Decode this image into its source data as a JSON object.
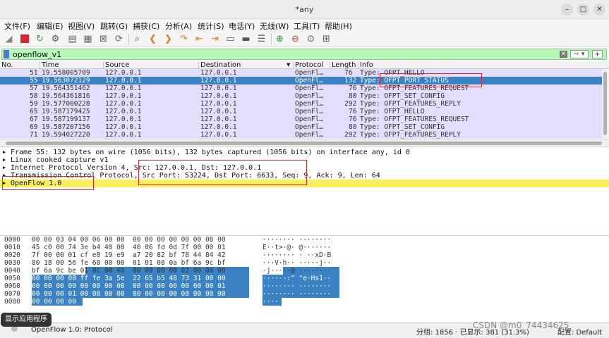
{
  "window": {
    "title": "*any"
  },
  "menu": [
    "文件(F)",
    "编辑(E)",
    "视图(V)",
    "跳转(G)",
    "捕获(C)",
    "分析(A)",
    "统计(S)",
    "电话(Y)",
    "无线(W)",
    "工具(T)",
    "帮助(H)"
  ],
  "filter": {
    "value": "openflow_v1",
    "clear": "✕",
    "arrow": "⇨ ▾",
    "add": "+"
  },
  "columns": {
    "no": "No.",
    "time": "Time",
    "source": "Source",
    "destination": "Destination",
    "protocol": "Protocol",
    "length": "Length",
    "info": "Info"
  },
  "packets": [
    {
      "no": "51",
      "time": "19.558005709",
      "source": "127.0.0.1",
      "destination": "127.0.0.1",
      "protocol": "OpenFl…",
      "length": "76",
      "info": "Type: OFPT_HELLO"
    },
    {
      "no": "55",
      "time": "19.563072129",
      "source": "127.0.0.1",
      "destination": "127.0.0.1",
      "protocol": "OpenFl…",
      "length": "132",
      "info": "Type: OFPT_PORT_STATUS"
    },
    {
      "no": "57",
      "time": "19.564351462",
      "source": "127.0.0.1",
      "destination": "127.0.0.1",
      "protocol": "OpenFl…",
      "length": "76",
      "info": "Type: OFPT_FEATURES_REQUEST"
    },
    {
      "no": "58",
      "time": "19.564361816",
      "source": "127.0.0.1",
      "destination": "127.0.0.1",
      "protocol": "OpenFl…",
      "length": "80",
      "info": "Type: OFPT_SET_CONFIG"
    },
    {
      "no": "59",
      "time": "19.577000228",
      "source": "127.0.0.1",
      "destination": "127.0.0.1",
      "protocol": "OpenFl…",
      "length": "292",
      "info": "Type: OFPT_FEATURES_REPLY"
    },
    {
      "no": "65",
      "time": "19.587179425",
      "source": "127.0.0.1",
      "destination": "127.0.0.1",
      "protocol": "OpenFl…",
      "length": "76",
      "info": "Type: OFPT_HELLO"
    },
    {
      "no": "67",
      "time": "19.587199137",
      "source": "127.0.0.1",
      "destination": "127.0.0.1",
      "protocol": "OpenFl…",
      "length": "76",
      "info": "Type: OFPT_FEATURES_REQUEST"
    },
    {
      "no": "69",
      "time": "19.587207156",
      "source": "127.0.0.1",
      "destination": "127.0.0.1",
      "protocol": "OpenFl…",
      "length": "80",
      "info": "Type: OFPT_SET_CONFIG"
    },
    {
      "no": "71",
      "time": "19.594027220",
      "source": "127.0.0.1",
      "destination": "127.0.0.1",
      "protocol": "OpenFl…",
      "length": "292",
      "info": "Type: OFPT_FEATURES_REPLY"
    }
  ],
  "details": [
    "Frame 55: 132 bytes on wire (1056 bits), 132 bytes captured (1056 bits) on interface any, id 0",
    "Linux cooked capture v1",
    "Internet Protocol Version 4, Src: 127.0.0.1, Dst: 127.0.0.1",
    "Transmission Control Protocol, Src Port: 53224, Dst Port: 6633, Seq: 9, Ack: 9, Len: 64",
    "OpenFlow 1.0"
  ],
  "hex": [
    {
      "offset": "0000",
      "bytes": "00 00 03 04 00 06 00 00  00 00 00 00 00 00 08 00",
      "ascii": "········ ········"
    },
    {
      "offset": "0010",
      "bytes": "45 c0 00 74 3e b4 40 00  40 06 fd 0d 7f 00 00 01",
      "ascii": "E··t>·@· @·······"
    },
    {
      "offset": "0020",
      "bytes": "7f 00 00 01 cf e8 19 e9  a7 20 82 bf 78 44 84 42",
      "ascii": "········ · ··xD·B"
    },
    {
      "offset": "0030",
      "bytes": "80 18 00 56 fe 68 00 00  01 01 08 0a bf 6a 9c bf",
      "ascii": "···V·h·· ·····j··"
    },
    {
      "offset": "0040",
      "bytes": "bf 6a 9c be 01 0c 00 40  00 00 00 00 02 00 00 00",
      "ascii": "·j·····@ ········"
    },
    {
      "offset": "0050",
      "bytes": "00 00 00 00 ff fe 3a 5e  22 65 b5 48 73 31 00 00",
      "ascii": "······:^ \"e·Hs1··"
    },
    {
      "offset": "0060",
      "bytes": "00 00 00 00 00 00 00 00  00 00 00 00 00 00 00 01",
      "ascii": "········ ········"
    },
    {
      "offset": "0070",
      "bytes": "00 00 00 01 00 00 00 00  00 00 00 00 00 00 00 00",
      "ascii": "········ ········"
    },
    {
      "offset": "0080",
      "bytes": "00 00 00 00",
      "ascii": "····"
    }
  ],
  "status": {
    "protocol": "OpenFlow 1.0: Protocol",
    "summary": "分组: 1856 · 已显示: 381 (31.3%)",
    "profile": "配置: Default"
  },
  "watermark": "CSDN @m0_74434625",
  "tooltip": "显示应用程序",
  "colors": {
    "selected": "#3a82c4",
    "row": "#e4ddfb",
    "filter": "#b7f7b7",
    "highlight": "#fbf05c",
    "annotation": "#e0282e"
  }
}
